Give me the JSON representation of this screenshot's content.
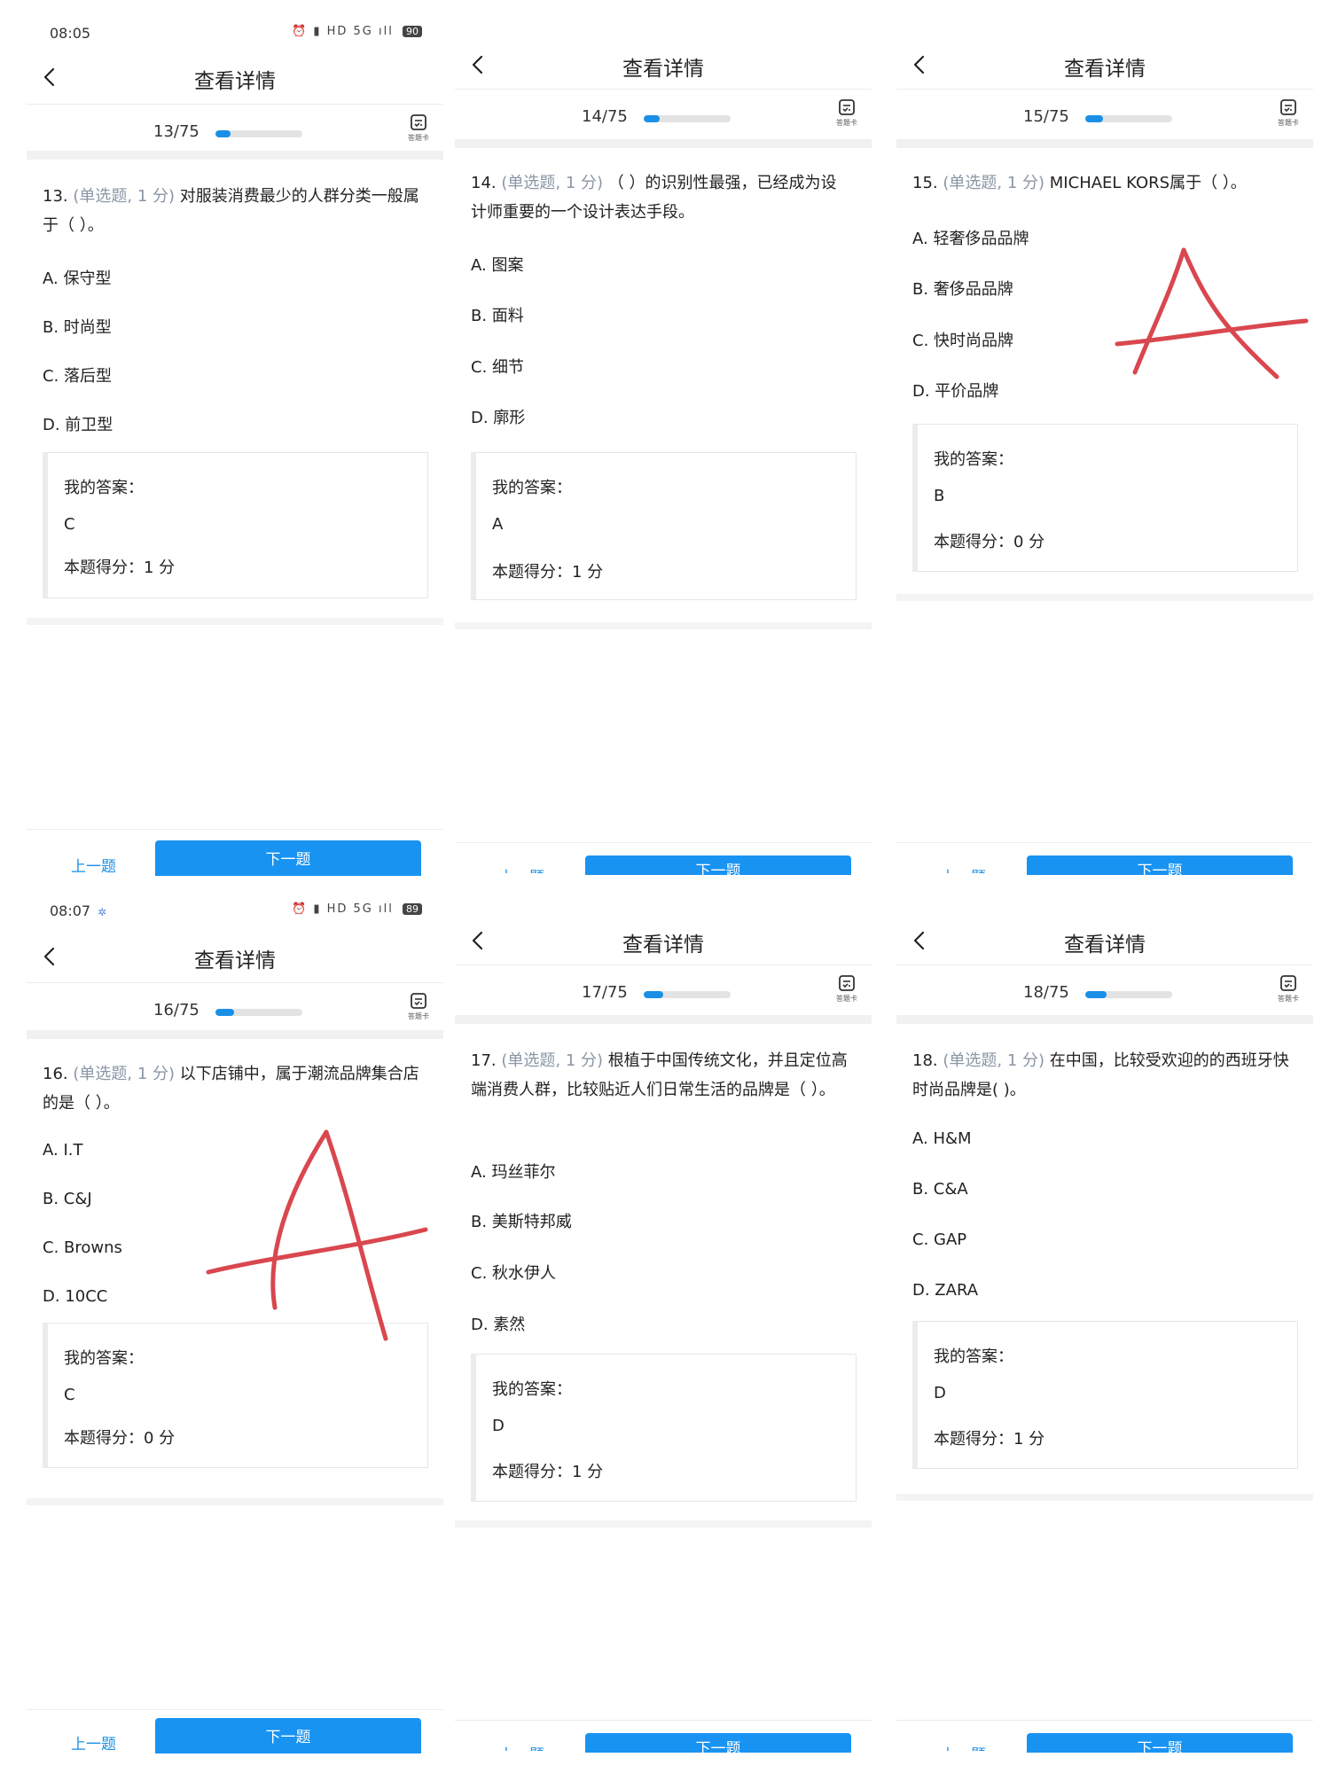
{
  "colors": {
    "accent": "#1893f2",
    "muted": "#8a96a5",
    "scribble": "#d9474f"
  },
  "panels": [
    {
      "status": {
        "time": "08:05",
        "icons": "⏰ ▮ HD 5G ıll",
        "battery": "90",
        "extra": ""
      },
      "title": "查看详情",
      "progress": {
        "text": "13/75",
        "fraction": 0.173
      },
      "answer_card_label": "答题卡",
      "question": {
        "num": "13.",
        "type": "(单选题, 1 分)",
        "text": "对服装消费最少的人群分类一般属于（ ）。"
      },
      "options": [
        "A. 保守型",
        "B. 时尚型",
        "C. 落后型",
        "D. 前卫型"
      ],
      "my_answer_label": "我的答案：",
      "my_answer": "C",
      "score_label": "本题得分：",
      "score": "1 分",
      "prev": "上一题",
      "next": "下一题"
    },
    {
      "status": {
        "time": "",
        "icons": "",
        "battery": "",
        "extra": ""
      },
      "title": "查看详情",
      "progress": {
        "text": "14/75",
        "fraction": 0.187
      },
      "answer_card_label": "答题卡",
      "question": {
        "num": "14.",
        "type": "(单选题, 1 分)",
        "text": "（ ）的识别性最强，已经成为设计师重要的一个设计表达手段。"
      },
      "options": [
        "A. 图案",
        "B. 面料",
        "C. 细节",
        "D. 廓形"
      ],
      "my_answer_label": "我的答案：",
      "my_answer": "A",
      "score_label": "本题得分：",
      "score": "1 分",
      "prev": "上一题",
      "next": "下一题"
    },
    {
      "status": {
        "time": "",
        "icons": "",
        "battery": "",
        "extra": ""
      },
      "title": "查看详情",
      "progress": {
        "text": "15/75",
        "fraction": 0.2
      },
      "answer_card_label": "答题卡",
      "question": {
        "num": "15.",
        "type": "(单选题, 1 分)",
        "text": "MICHAEL KORS属于（ ）。"
      },
      "options": [
        "A. 轻奢侈品品牌",
        "B. 奢侈品品牌",
        "C. 快时尚品牌",
        "D. 平价品牌"
      ],
      "my_answer_label": "我的答案：",
      "my_answer": "B",
      "score_label": "本题得分：",
      "score": "0 分",
      "prev": "上一题",
      "next": "下一题"
    },
    {
      "status": {
        "time": "08:07",
        "icons": "⏰ ▮ HD 5G ıll",
        "battery": "89",
        "extra": "✲"
      },
      "title": "查看详情",
      "progress": {
        "text": "16/75",
        "fraction": 0.213
      },
      "answer_card_label": "答题卡",
      "question": {
        "num": "16.",
        "type": "(单选题, 1 分)",
        "text": "以下店铺中，属于潮流品牌集合店的是（ ）。"
      },
      "options": [
        "A. I.T",
        "B. C&J",
        "C. Browns",
        "D. 10CC"
      ],
      "my_answer_label": "我的答案：",
      "my_answer": "C",
      "score_label": "本题得分：",
      "score": "0 分",
      "prev": "上一题",
      "next": "下一题"
    },
    {
      "status": {
        "time": "",
        "icons": "",
        "battery": "",
        "extra": ""
      },
      "title": "查看详情",
      "progress": {
        "text": "17/75",
        "fraction": 0.227
      },
      "answer_card_label": "答题卡",
      "question": {
        "num": "17.",
        "type": "(单选题, 1 分)",
        "text": "根植于中国传统文化，并且定位高端消费人群，比较贴近人们日常生活的品牌是（ ）。"
      },
      "options": [
        "A. 玛丝菲尔",
        "B. 美斯特邦威",
        "C. 秋水伊人",
        "D. 素然"
      ],
      "my_answer_label": "我的答案：",
      "my_answer": "D",
      "score_label": "本题得分：",
      "score": "1 分",
      "prev": "上一题",
      "next": "下一题"
    },
    {
      "status": {
        "time": "",
        "icons": "",
        "battery": "",
        "extra": ""
      },
      "title": "查看详情",
      "progress": {
        "text": "18/75",
        "fraction": 0.24
      },
      "answer_card_label": "答题卡",
      "question": {
        "num": "18.",
        "type": "(单选题, 1 分)",
        "text": "在中国，比较受欢迎的的西班牙快时尚品牌是( )。"
      },
      "options": [
        "A. H&M",
        "B. C&A",
        "C. GAP",
        "D. ZARA"
      ],
      "my_answer_label": "我的答案：",
      "my_answer": "D",
      "score_label": "本题得分：",
      "score": "1 分",
      "prev": "上一题",
      "next": "下一题"
    }
  ]
}
